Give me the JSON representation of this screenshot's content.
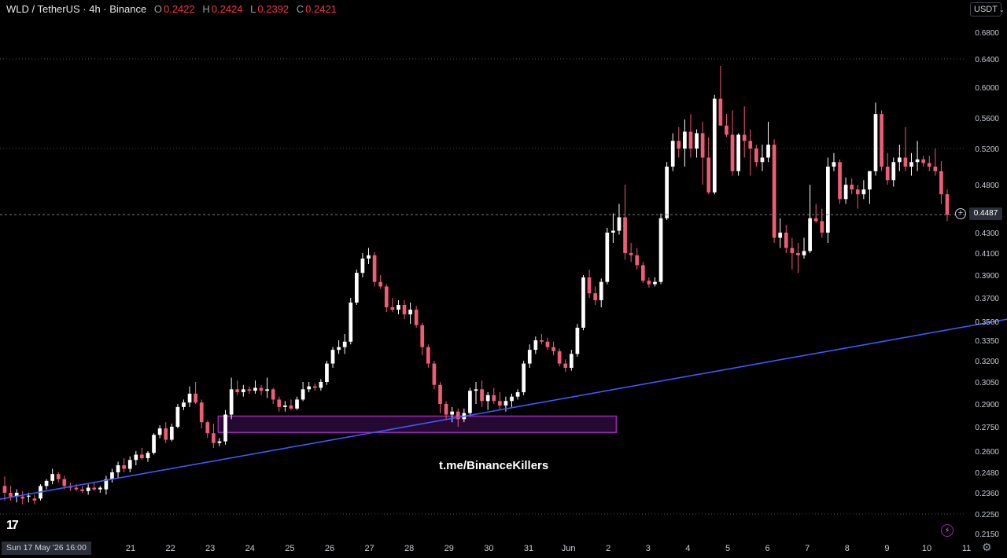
{
  "header": {
    "symbol": "WLD / TetherUS · 4h · Binance",
    "o_label": "O",
    "o_value": "0.2422",
    "h_label": "H",
    "h_value": "0.2424",
    "l_label": "L",
    "l_value": "0.2392",
    "c_label": "C",
    "c_value": "0.2421"
  },
  "currency_selector": {
    "label": "USDT",
    "caret": "⌄"
  },
  "current_price": "0.4487",
  "start_label": "Sun 17 May '26   16:00",
  "watermark": "t.me/BinanceKillers",
  "colors": {
    "up": "#ffffff",
    "down": "#ef5d75",
    "trendline": "#3d5afe",
    "zone_border": "#9c27b0",
    "zone_fill": "#2a0a3a"
  },
  "icons": {
    "logo": "tradingview-logo-icon",
    "add": "plus-circle-icon",
    "alert": "flash-icon",
    "settings": "gear-icon"
  },
  "chart_data": {
    "type": "candlestick",
    "y_ticks": [
      "0.6800",
      "0.6400",
      "0.6000",
      "0.5600",
      "0.5200",
      "0.4800",
      "0.4300",
      "0.4100",
      "0.3900",
      "0.3700",
      "0.3500",
      "0.3350",
      "0.3200",
      "0.3050",
      "0.2900",
      "0.2750",
      "0.2600",
      "0.2480",
      "0.2360",
      "0.2250",
      "0.2150"
    ],
    "x_ticks": [
      "21",
      "22",
      "23",
      "24",
      "25",
      "26",
      "27",
      "28",
      "29",
      "30",
      "31",
      "Jun",
      "2",
      "3",
      "4",
      "5",
      "6",
      "7",
      "8",
      "9",
      "10",
      "11"
    ],
    "horizontal_levels": [
      0.64,
      0.52,
      0.225
    ],
    "support_zone": {
      "low": 0.2715,
      "high": 0.282,
      "from": "May 23",
      "to": "Jun 2"
    },
    "trendline": {
      "from": [
        "May 17",
        0.23
      ],
      "to": [
        "Jun 11",
        0.353
      ]
    },
    "candles": [
      {
        "o": 0.24,
        "h": 0.2455,
        "l": 0.232,
        "c": 0.236
      },
      {
        "o": 0.236,
        "h": 0.24,
        "l": 0.232,
        "c": 0.234
      },
      {
        "o": 0.234,
        "h": 0.238,
        "l": 0.231,
        "c": 0.236
      },
      {
        "o": 0.234,
        "h": 0.237,
        "l": 0.23,
        "c": 0.233
      },
      {
        "o": 0.234,
        "h": 0.236,
        "l": 0.231,
        "c": 0.2345
      },
      {
        "o": 0.233,
        "h": 0.235,
        "l": 0.23,
        "c": 0.232
      },
      {
        "o": 0.233,
        "h": 0.241,
        "l": 0.232,
        "c": 0.24
      },
      {
        "o": 0.24,
        "h": 0.244,
        "l": 0.238,
        "c": 0.243
      },
      {
        "o": 0.243,
        "h": 0.25,
        "l": 0.241,
        "c": 0.247
      },
      {
        "o": 0.247,
        "h": 0.248,
        "l": 0.242,
        "c": 0.244
      },
      {
        "o": 0.244,
        "h": 0.246,
        "l": 0.238,
        "c": 0.24
      },
      {
        "o": 0.24,
        "h": 0.242,
        "l": 0.237,
        "c": 0.239
      },
      {
        "o": 0.239,
        "h": 0.241,
        "l": 0.237,
        "c": 0.238
      },
      {
        "o": 0.238,
        "h": 0.24,
        "l": 0.236,
        "c": 0.237
      },
      {
        "o": 0.237,
        "h": 0.241,
        "l": 0.235,
        "c": 0.239
      },
      {
        "o": 0.239,
        "h": 0.242,
        "l": 0.237,
        "c": 0.238
      },
      {
        "o": 0.238,
        "h": 0.24,
        "l": 0.236,
        "c": 0.239
      },
      {
        "o": 0.238,
        "h": 0.246,
        "l": 0.235,
        "c": 0.244
      },
      {
        "o": 0.244,
        "h": 0.25,
        "l": 0.242,
        "c": 0.248
      },
      {
        "o": 0.248,
        "h": 0.254,
        "l": 0.245,
        "c": 0.252
      },
      {
        "o": 0.252,
        "h": 0.256,
        "l": 0.248,
        "c": 0.25
      },
      {
        "o": 0.25,
        "h": 0.257,
        "l": 0.248,
        "c": 0.255
      },
      {
        "o": 0.255,
        "h": 0.26,
        "l": 0.252,
        "c": 0.258
      },
      {
        "o": 0.258,
        "h": 0.262,
        "l": 0.255,
        "c": 0.256
      },
      {
        "o": 0.256,
        "h": 0.26,
        "l": 0.254,
        "c": 0.259
      },
      {
        "o": 0.259,
        "h": 0.271,
        "l": 0.258,
        "c": 0.27
      },
      {
        "o": 0.27,
        "h": 0.276,
        "l": 0.268,
        "c": 0.274
      },
      {
        "o": 0.274,
        "h": 0.278,
        "l": 0.265,
        "c": 0.267
      },
      {
        "o": 0.267,
        "h": 0.277,
        "l": 0.266,
        "c": 0.275
      },
      {
        "o": 0.275,
        "h": 0.29,
        "l": 0.274,
        "c": 0.288
      },
      {
        "o": 0.288,
        "h": 0.293,
        "l": 0.286,
        "c": 0.291
      },
      {
        "o": 0.291,
        "h": 0.302,
        "l": 0.288,
        "c": 0.297
      },
      {
        "o": 0.297,
        "h": 0.305,
        "l": 0.29,
        "c": 0.291
      },
      {
        "o": 0.291,
        "h": 0.293,
        "l": 0.274,
        "c": 0.278
      },
      {
        "o": 0.278,
        "h": 0.279,
        "l": 0.268,
        "c": 0.271
      },
      {
        "o": 0.271,
        "h": 0.277,
        "l": 0.262,
        "c": 0.265
      },
      {
        "o": 0.265,
        "h": 0.268,
        "l": 0.263,
        "c": 0.266
      },
      {
        "o": 0.266,
        "h": 0.286,
        "l": 0.264,
        "c": 0.283
      },
      {
        "o": 0.283,
        "h": 0.308,
        "l": 0.28,
        "c": 0.3
      },
      {
        "o": 0.3,
        "h": 0.306,
        "l": 0.296,
        "c": 0.298
      },
      {
        "o": 0.298,
        "h": 0.303,
        "l": 0.295,
        "c": 0.3
      },
      {
        "o": 0.3,
        "h": 0.302,
        "l": 0.297,
        "c": 0.299
      },
      {
        "o": 0.299,
        "h": 0.306,
        "l": 0.297,
        "c": 0.301
      },
      {
        "o": 0.301,
        "h": 0.303,
        "l": 0.296,
        "c": 0.299
      },
      {
        "o": 0.299,
        "h": 0.308,
        "l": 0.294,
        "c": 0.3
      },
      {
        "o": 0.3,
        "h": 0.301,
        "l": 0.29,
        "c": 0.293
      },
      {
        "o": 0.293,
        "h": 0.295,
        "l": 0.285,
        "c": 0.288
      },
      {
        "o": 0.288,
        "h": 0.292,
        "l": 0.285,
        "c": 0.289
      },
      {
        "o": 0.289,
        "h": 0.293,
        "l": 0.286,
        "c": 0.287
      },
      {
        "o": 0.287,
        "h": 0.295,
        "l": 0.286,
        "c": 0.293
      },
      {
        "o": 0.293,
        "h": 0.305,
        "l": 0.292,
        "c": 0.3
      },
      {
        "o": 0.3,
        "h": 0.305,
        "l": 0.298,
        "c": 0.302
      },
      {
        "o": 0.302,
        "h": 0.304,
        "l": 0.299,
        "c": 0.301
      },
      {
        "o": 0.301,
        "h": 0.307,
        "l": 0.299,
        "c": 0.305
      },
      {
        "o": 0.305,
        "h": 0.32,
        "l": 0.303,
        "c": 0.318
      },
      {
        "o": 0.318,
        "h": 0.33,
        "l": 0.315,
        "c": 0.328
      },
      {
        "o": 0.328,
        "h": 0.335,
        "l": 0.325,
        "c": 0.33
      },
      {
        "o": 0.33,
        "h": 0.34,
        "l": 0.325,
        "c": 0.334
      },
      {
        "o": 0.334,
        "h": 0.37,
        "l": 0.332,
        "c": 0.366
      },
      {
        "o": 0.366,
        "h": 0.395,
        "l": 0.364,
        "c": 0.392
      },
      {
        "o": 0.392,
        "h": 0.41,
        "l": 0.388,
        "c": 0.405
      },
      {
        "o": 0.405,
        "h": 0.415,
        "l": 0.4,
        "c": 0.408
      },
      {
        "o": 0.408,
        "h": 0.411,
        "l": 0.38,
        "c": 0.384
      },
      {
        "o": 0.384,
        "h": 0.39,
        "l": 0.378,
        "c": 0.38
      },
      {
        "o": 0.38,
        "h": 0.382,
        "l": 0.358,
        "c": 0.362
      },
      {
        "o": 0.362,
        "h": 0.37,
        "l": 0.358,
        "c": 0.36
      },
      {
        "o": 0.36,
        "h": 0.368,
        "l": 0.356,
        "c": 0.364
      },
      {
        "o": 0.364,
        "h": 0.368,
        "l": 0.352,
        "c": 0.356
      },
      {
        "o": 0.356,
        "h": 0.366,
        "l": 0.348,
        "c": 0.36
      },
      {
        "o": 0.36,
        "h": 0.363,
        "l": 0.345,
        "c": 0.347
      },
      {
        "o": 0.347,
        "h": 0.349,
        "l": 0.324,
        "c": 0.33
      },
      {
        "o": 0.33,
        "h": 0.332,
        "l": 0.315,
        "c": 0.318
      },
      {
        "o": 0.318,
        "h": 0.32,
        "l": 0.3,
        "c": 0.303
      },
      {
        "o": 0.303,
        "h": 0.305,
        "l": 0.284,
        "c": 0.29
      },
      {
        "o": 0.29,
        "h": 0.292,
        "l": 0.28,
        "c": 0.283
      },
      {
        "o": 0.283,
        "h": 0.288,
        "l": 0.278,
        "c": 0.285
      },
      {
        "o": 0.285,
        "h": 0.287,
        "l": 0.275,
        "c": 0.28
      },
      {
        "o": 0.28,
        "h": 0.287,
        "l": 0.278,
        "c": 0.284
      },
      {
        "o": 0.284,
        "h": 0.301,
        "l": 0.282,
        "c": 0.299
      },
      {
        "o": 0.299,
        "h": 0.305,
        "l": 0.29,
        "c": 0.3
      },
      {
        "o": 0.3,
        "h": 0.306,
        "l": 0.288,
        "c": 0.292
      },
      {
        "o": 0.292,
        "h": 0.298,
        "l": 0.286,
        "c": 0.296
      },
      {
        "o": 0.296,
        "h": 0.301,
        "l": 0.29,
        "c": 0.292
      },
      {
        "o": 0.292,
        "h": 0.298,
        "l": 0.286,
        "c": 0.289
      },
      {
        "o": 0.289,
        "h": 0.295,
        "l": 0.285,
        "c": 0.292
      },
      {
        "o": 0.292,
        "h": 0.297,
        "l": 0.288,
        "c": 0.295
      },
      {
        "o": 0.295,
        "h": 0.3,
        "l": 0.293,
        "c": 0.298
      },
      {
        "o": 0.298,
        "h": 0.32,
        "l": 0.296,
        "c": 0.318
      },
      {
        "o": 0.318,
        "h": 0.332,
        "l": 0.315,
        "c": 0.328
      },
      {
        "o": 0.328,
        "h": 0.338,
        "l": 0.325,
        "c": 0.335
      },
      {
        "o": 0.335,
        "h": 0.34,
        "l": 0.332,
        "c": 0.334
      },
      {
        "o": 0.334,
        "h": 0.337,
        "l": 0.328,
        "c": 0.33
      },
      {
        "o": 0.33,
        "h": 0.334,
        "l": 0.324,
        "c": 0.327
      },
      {
        "o": 0.327,
        "h": 0.329,
        "l": 0.316,
        "c": 0.318
      },
      {
        "o": 0.318,
        "h": 0.321,
        "l": 0.312,
        "c": 0.315
      },
      {
        "o": 0.315,
        "h": 0.328,
        "l": 0.313,
        "c": 0.325
      },
      {
        "o": 0.325,
        "h": 0.348,
        "l": 0.323,
        "c": 0.345
      },
      {
        "o": 0.345,
        "h": 0.39,
        "l": 0.343,
        "c": 0.388
      },
      {
        "o": 0.388,
        "h": 0.395,
        "l": 0.37,
        "c": 0.374
      },
      {
        "o": 0.374,
        "h": 0.38,
        "l": 0.364,
        "c": 0.368
      },
      {
        "o": 0.368,
        "h": 0.387,
        "l": 0.362,
        "c": 0.384
      },
      {
        "o": 0.384,
        "h": 0.435,
        "l": 0.382,
        "c": 0.43
      },
      {
        "o": 0.43,
        "h": 0.45,
        "l": 0.42,
        "c": 0.432
      },
      {
        "o": 0.432,
        "h": 0.46,
        "l": 0.428,
        "c": 0.446
      },
      {
        "o": 0.446,
        "h": 0.48,
        "l": 0.404,
        "c": 0.41
      },
      {
        "o": 0.41,
        "h": 0.42,
        "l": 0.402,
        "c": 0.408
      },
      {
        "o": 0.408,
        "h": 0.415,
        "l": 0.395,
        "c": 0.399
      },
      {
        "o": 0.399,
        "h": 0.402,
        "l": 0.383,
        "c": 0.385
      },
      {
        "o": 0.385,
        "h": 0.388,
        "l": 0.379,
        "c": 0.382
      },
      {
        "o": 0.382,
        "h": 0.388,
        "l": 0.38,
        "c": 0.384
      },
      {
        "o": 0.384,
        "h": 0.45,
        "l": 0.382,
        "c": 0.445
      },
      {
        "o": 0.445,
        "h": 0.505,
        "l": 0.443,
        "c": 0.5
      },
      {
        "o": 0.5,
        "h": 0.54,
        "l": 0.495,
        "c": 0.53
      },
      {
        "o": 0.53,
        "h": 0.548,
        "l": 0.51,
        "c": 0.52
      },
      {
        "o": 0.52,
        "h": 0.558,
        "l": 0.5,
        "c": 0.542
      },
      {
        "o": 0.542,
        "h": 0.565,
        "l": 0.51,
        "c": 0.52
      },
      {
        "o": 0.52,
        "h": 0.545,
        "l": 0.51,
        "c": 0.54
      },
      {
        "o": 0.54,
        "h": 0.555,
        "l": 0.48,
        "c": 0.51
      },
      {
        "o": 0.51,
        "h": 0.535,
        "l": 0.47,
        "c": 0.472
      },
      {
        "o": 0.472,
        "h": 0.59,
        "l": 0.47,
        "c": 0.585
      },
      {
        "o": 0.585,
        "h": 0.63,
        "l": 0.55,
        "c": 0.55
      },
      {
        "o": 0.55,
        "h": 0.565,
        "l": 0.535,
        "c": 0.538
      },
      {
        "o": 0.538,
        "h": 0.57,
        "l": 0.49,
        "c": 0.495
      },
      {
        "o": 0.495,
        "h": 0.54,
        "l": 0.49,
        "c": 0.538
      },
      {
        "o": 0.538,
        "h": 0.575,
        "l": 0.51,
        "c": 0.53
      },
      {
        "o": 0.53,
        "h": 0.545,
        "l": 0.49,
        "c": 0.52
      },
      {
        "o": 0.52,
        "h": 0.525,
        "l": 0.5,
        "c": 0.505
      },
      {
        "o": 0.505,
        "h": 0.525,
        "l": 0.495,
        "c": 0.51
      },
      {
        "o": 0.51,
        "h": 0.555,
        "l": 0.505,
        "c": 0.525
      },
      {
        "o": 0.525,
        "h": 0.532,
        "l": 0.42,
        "c": 0.425
      },
      {
        "o": 0.425,
        "h": 0.445,
        "l": 0.415,
        "c": 0.43
      },
      {
        "o": 0.43,
        "h": 0.438,
        "l": 0.41,
        "c": 0.415
      },
      {
        "o": 0.415,
        "h": 0.425,
        "l": 0.395,
        "c": 0.41
      },
      {
        "o": 0.41,
        "h": 0.42,
        "l": 0.392,
        "c": 0.408
      },
      {
        "o": 0.408,
        "h": 0.425,
        "l": 0.405,
        "c": 0.412
      },
      {
        "o": 0.412,
        "h": 0.48,
        "l": 0.41,
        "c": 0.445
      },
      {
        "o": 0.445,
        "h": 0.46,
        "l": 0.44,
        "c": 0.442
      },
      {
        "o": 0.442,
        "h": 0.455,
        "l": 0.425,
        "c": 0.43
      },
      {
        "o": 0.43,
        "h": 0.51,
        "l": 0.42,
        "c": 0.5
      },
      {
        "o": 0.5,
        "h": 0.515,
        "l": 0.495,
        "c": 0.505
      },
      {
        "o": 0.505,
        "h": 0.508,
        "l": 0.46,
        "c": 0.465
      },
      {
        "o": 0.465,
        "h": 0.488,
        "l": 0.46,
        "c": 0.48
      },
      {
        "o": 0.48,
        "h": 0.487,
        "l": 0.47,
        "c": 0.475
      },
      {
        "o": 0.475,
        "h": 0.48,
        "l": 0.455,
        "c": 0.47
      },
      {
        "o": 0.47,
        "h": 0.485,
        "l": 0.465,
        "c": 0.475
      },
      {
        "o": 0.475,
        "h": 0.49,
        "l": 0.46,
        "c": 0.495
      },
      {
        "o": 0.495,
        "h": 0.58,
        "l": 0.49,
        "c": 0.565
      },
      {
        "o": 0.565,
        "h": 0.57,
        "l": 0.495,
        "c": 0.5
      },
      {
        "o": 0.5,
        "h": 0.515,
        "l": 0.48,
        "c": 0.485
      },
      {
        "o": 0.485,
        "h": 0.51,
        "l": 0.478,
        "c": 0.505
      },
      {
        "o": 0.505,
        "h": 0.525,
        "l": 0.495,
        "c": 0.51
      },
      {
        "o": 0.51,
        "h": 0.548,
        "l": 0.495,
        "c": 0.5
      },
      {
        "o": 0.5,
        "h": 0.515,
        "l": 0.49,
        "c": 0.505
      },
      {
        "o": 0.505,
        "h": 0.53,
        "l": 0.495,
        "c": 0.508
      },
      {
        "o": 0.508,
        "h": 0.512,
        "l": 0.5,
        "c": 0.504
      },
      {
        "o": 0.504,
        "h": 0.512,
        "l": 0.495,
        "c": 0.5
      },
      {
        "o": 0.5,
        "h": 0.52,
        "l": 0.49,
        "c": 0.495
      },
      {
        "o": 0.495,
        "h": 0.506,
        "l": 0.46,
        "c": 0.47
      },
      {
        "o": 0.47,
        "h": 0.475,
        "l": 0.442,
        "c": 0.4487
      }
    ]
  }
}
